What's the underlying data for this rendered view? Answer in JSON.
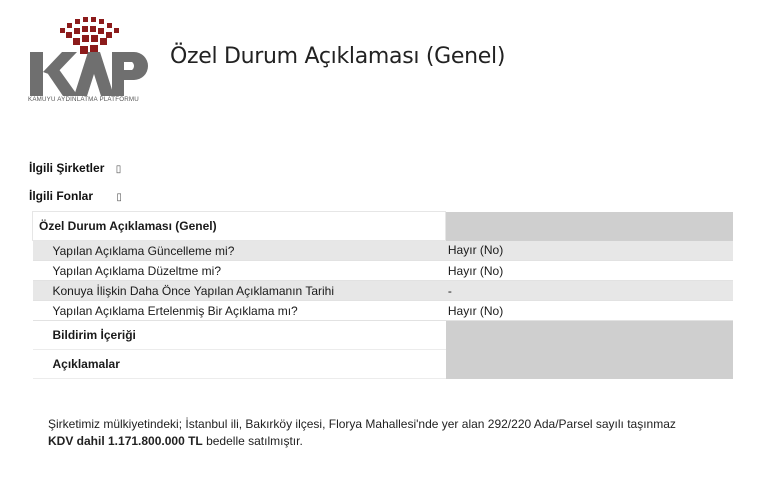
{
  "logo": {
    "wordmark": "KAP",
    "caption": "KAMUYU AYDINLATMA PLATFORMU",
    "colors": {
      "dark": "#6f6f6f",
      "accent": "#8c1b1b"
    }
  },
  "page_title": "Özel Durum Açıklaması (Genel)",
  "related": {
    "companies_label": "İlgili Şirketler",
    "companies_toggle": "▯",
    "funds_label": "İlgili Fonlar",
    "funds_toggle": "▯"
  },
  "table": {
    "header": "Özel Durum Açıklaması (Genel)",
    "rows": [
      {
        "question": "Yapılan Açıklama Güncelleme mi?",
        "answer": "Hayır (No)"
      },
      {
        "question": "Yapılan Açıklama Düzeltme mi?",
        "answer": "Hayır (No)"
      },
      {
        "question": "Konuya İlişkin Daha Önce Yapılan Açıklamanın Tarihi",
        "answer": "-"
      },
      {
        "question": "Yapılan Açıklama Ertelenmiş Bir Açıklama mı?",
        "answer": "Hayır (No)"
      }
    ],
    "section_content": "Bildirim İçeriği",
    "section_explanations": "Açıklamalar"
  },
  "body": {
    "line1": "Şirketimiz mülkiyetindeki; İstanbul ili, Bakırköy ilçesi, Florya Mahallesi'nde yer alan 292/220 Ada/Parsel sayılı taşınmaz",
    "line2_bold": "KDV dahil 1.171.800.000 TL",
    "line2_rest": " bedelle satılmıştır."
  },
  "colors": {
    "row_shade": "#e7e7e7",
    "answer_block": "#cfcfcf"
  }
}
